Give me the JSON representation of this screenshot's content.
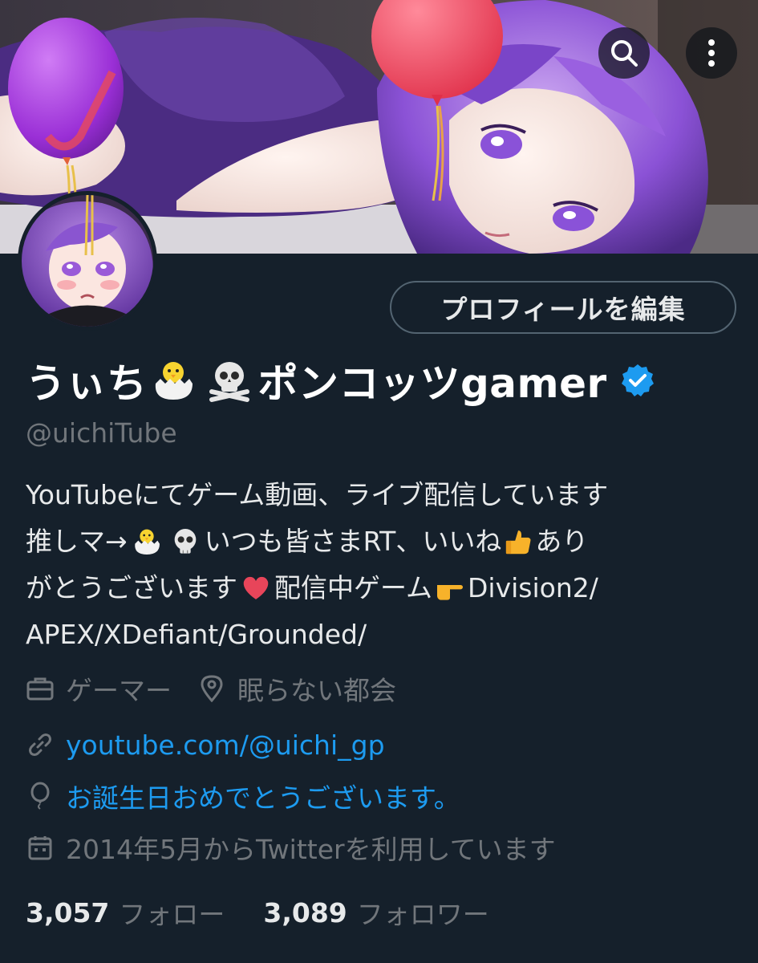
{
  "colors": {
    "background": "#15202b",
    "primary_text": "#e7e9ea",
    "secondary_text": "#71767b",
    "link": "#1d9bf0",
    "verified": "#1d9bf0",
    "button_border": "#536471"
  },
  "header": {
    "search_icon": "search-icon",
    "more_icon": "more-vertical-icon"
  },
  "profile": {
    "edit_button_label": "プロフィールを編集",
    "name_part1": "うぃち",
    "name_part2": "ポンコッツgamer",
    "name_emojis": [
      "hatching-chick-emoji",
      "skull-crossbones-emoji"
    ],
    "verified_icon": "verified-badge-icon",
    "handle": "@uichiTube"
  },
  "bio": {
    "line1": "YouTubeにてゲーム動画、ライブ配信しています",
    "line2_a": "推しマ→",
    "line2_b": " いつも皆さまRT、いいね",
    "line2_c": "あり",
    "line3_a": "がとうございます",
    "line3_b": " 配信中ゲーム",
    "line3_c": "Division2/",
    "line4": "APEX/XDefiant/Grounded/"
  },
  "meta": {
    "profession": "ゲーマー",
    "location": "眠らない都会",
    "website": "youtube.com/@uichi_gp",
    "birthday": "お誕生日おめでとうございます。",
    "joined": "2014年5月からTwitterを利用しています"
  },
  "stats": {
    "following_count": "3,057",
    "following_label": "フォロー",
    "followers_count": "3,089",
    "followers_label": "フォロワー"
  }
}
